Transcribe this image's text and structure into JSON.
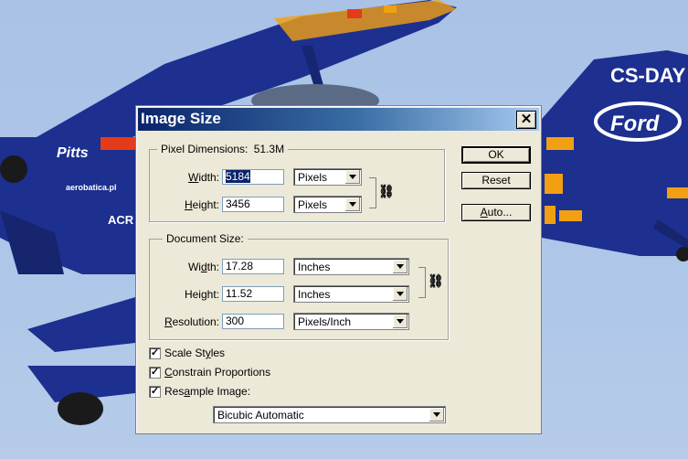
{
  "background": {
    "plane_texts": [
      "CS-DAY",
      "Ford",
      "Pitts",
      "aerobatica.pl",
      "ACR"
    ],
    "colors": {
      "sky": "#aec7e8",
      "plane_blue": "#1d2f8f",
      "accent_orange": "#f2a012"
    }
  },
  "dialog": {
    "title": "Image Size",
    "close_icon": "close-icon",
    "pixel_dimensions": {
      "legend": "Pixel Dimensions:",
      "size": "51.3M",
      "width_label_pre": "W",
      "width_label_post": "idth:",
      "width_value": "5184",
      "width_unit": "Pixels",
      "height_label_pre": "H",
      "height_label_post": "eight:",
      "height_value": "3456",
      "height_unit": "Pixels"
    },
    "document_size": {
      "legend": "Document Size:",
      "width_label_pre": "Wi",
      "width_label_u": "d",
      "width_label_post": "th:",
      "width_value": "17.28",
      "width_unit": "Inches",
      "height_label_pre": "Hei",
      "height_label_u": "g",
      "height_label_post": "ht:",
      "height_value": "11.52",
      "height_unit": "Inches",
      "resolution_label_u": "R",
      "resolution_label_post": "esolution:",
      "resolution_value": "300",
      "resolution_unit": "Pixels/Inch"
    },
    "buttons": {
      "ok": "OK",
      "reset": "Reset",
      "auto_u": "A",
      "auto_post": "uto..."
    },
    "checkboxes": {
      "scale_styles_pre": "Scale St",
      "scale_styles_u": "y",
      "scale_styles_post": "les",
      "constrain_u": "C",
      "constrain_post": "onstrain Proportions",
      "resample_pre": "Res",
      "resample_u": "a",
      "resample_post": "mple Image:",
      "checked_mark": "✓"
    },
    "resample_method": "Bicubic Automatic",
    "link_icon": "⛓"
  }
}
